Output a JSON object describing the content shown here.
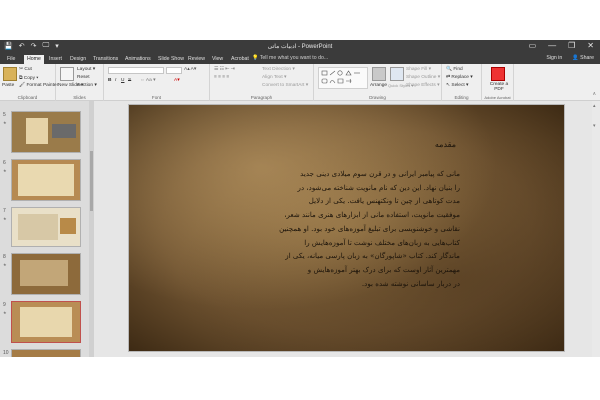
{
  "titlebar": {
    "title": "ادبیات ماتی - PowerPoint",
    "qat": [
      "💾",
      "↶",
      "↷",
      "🖵",
      "▾"
    ],
    "win": [
      "▭",
      "—",
      "❐",
      "✕"
    ]
  },
  "tabs": [
    "File",
    "Home",
    "Insert",
    "Design",
    "Transitions",
    "Animations",
    "Slide Show",
    "Review",
    "View",
    "Acrobat"
  ],
  "tell_me": "Tell me what you want to do...",
  "signin": "Sign in",
  "share": "Share",
  "ribbon": {
    "clipboard": {
      "paste": "Paste",
      "cut": "Cut",
      "copy": "Copy ▾",
      "format_painter": "Format Painter",
      "label": "Clipboard"
    },
    "slides": {
      "new_slide": "New Slide ▾",
      "layout": "Layout ▾",
      "reset": "Reset",
      "section": "Section ▾",
      "label": "Slides"
    },
    "font": {
      "bold": "B",
      "italic": "I",
      "underline": "U",
      "strike": "S",
      "label": "Font"
    },
    "paragraph": {
      "text_direction": "Text Direction ▾",
      "align_text": "Align Text ▾",
      "convert_smartart": "Convert to SmartArt ▾",
      "label": "Paragraph"
    },
    "drawing": {
      "arrange": "Arrange",
      "quick_styles": "Quick Styles ▾",
      "shape_fill": "Shape Fill ▾",
      "shape_outline": "Shape Outline ▾",
      "shape_effects": "Shape Effects ▾",
      "label": "Drawing"
    },
    "editing": {
      "find": "Find",
      "replace": "Replace ▾",
      "select": "Select ▾",
      "label": "Editing"
    },
    "acrobat": {
      "create_pdf": "Create a PDF",
      "label": "Adobe Acrobat"
    }
  },
  "thumbnails": [
    {
      "num": "5"
    },
    {
      "num": "6"
    },
    {
      "num": "7"
    },
    {
      "num": "8"
    },
    {
      "num": "9"
    },
    {
      "num": "10"
    }
  ],
  "slide": {
    "heading": "مقدمه",
    "lines": [
      "مانی که پیامبر ایرانی و در قرن سوم میلادی دینی جدید",
      "را بنیان نهاد. این دین که نام مانویت شناخته می‌شود، در",
      "مدت کوتاهی از چین تا ونکتهنس یافت. یکی از دلایل",
      "موفقیت مانویت، استفاده مانی از ابزارهای هنری مانند شعر،",
      "نقاشی و خوشنویسی برای تبلیغ آموزه‌های خود بود. او همچنین",
      "کتاب‌هایی به زبان‌های مختلف نوشت تا آموزه‌هایش را",
      "ماندگار کند. کتاب «شاپورگان» به زبان پارسی میانه، یکی از",
      "مهمترین آثار اوست که برای درک بهتر آموزه‌هایش و",
      "در دربار ساسانی نوشته شده بود."
    ]
  },
  "colors": {
    "chrome_dark": "#3b3b3b",
    "ribbon": "#efefef",
    "accent": "#c0504d"
  }
}
